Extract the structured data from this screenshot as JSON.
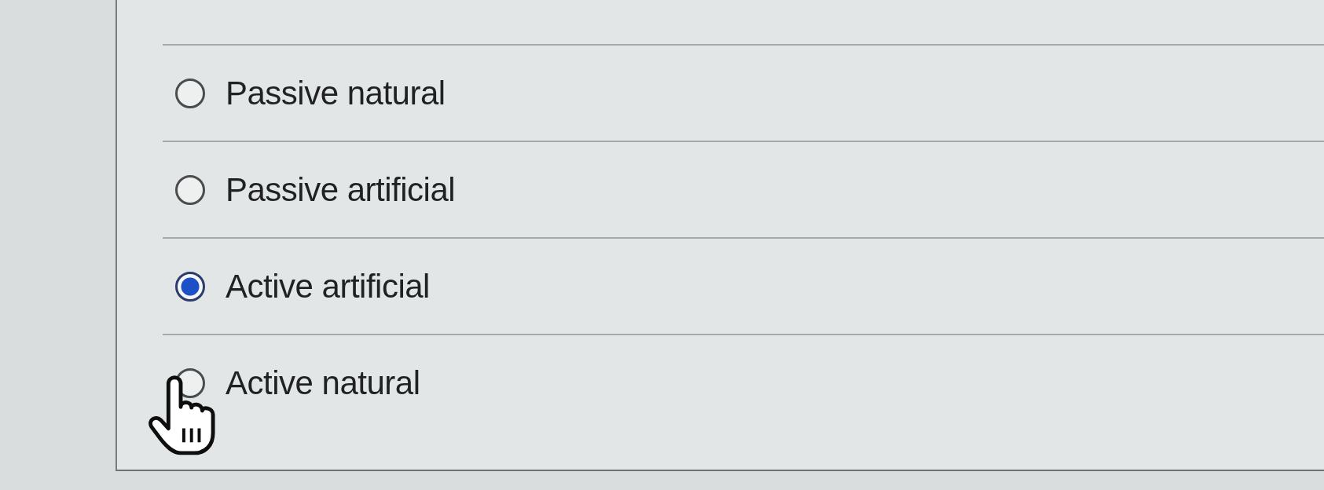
{
  "question": {
    "options": [
      {
        "label": "Passive natural",
        "selected": false
      },
      {
        "label": "Passive artificial",
        "selected": false
      },
      {
        "label": "Active artificial",
        "selected": true
      },
      {
        "label": "Active natural",
        "selected": false
      }
    ]
  }
}
